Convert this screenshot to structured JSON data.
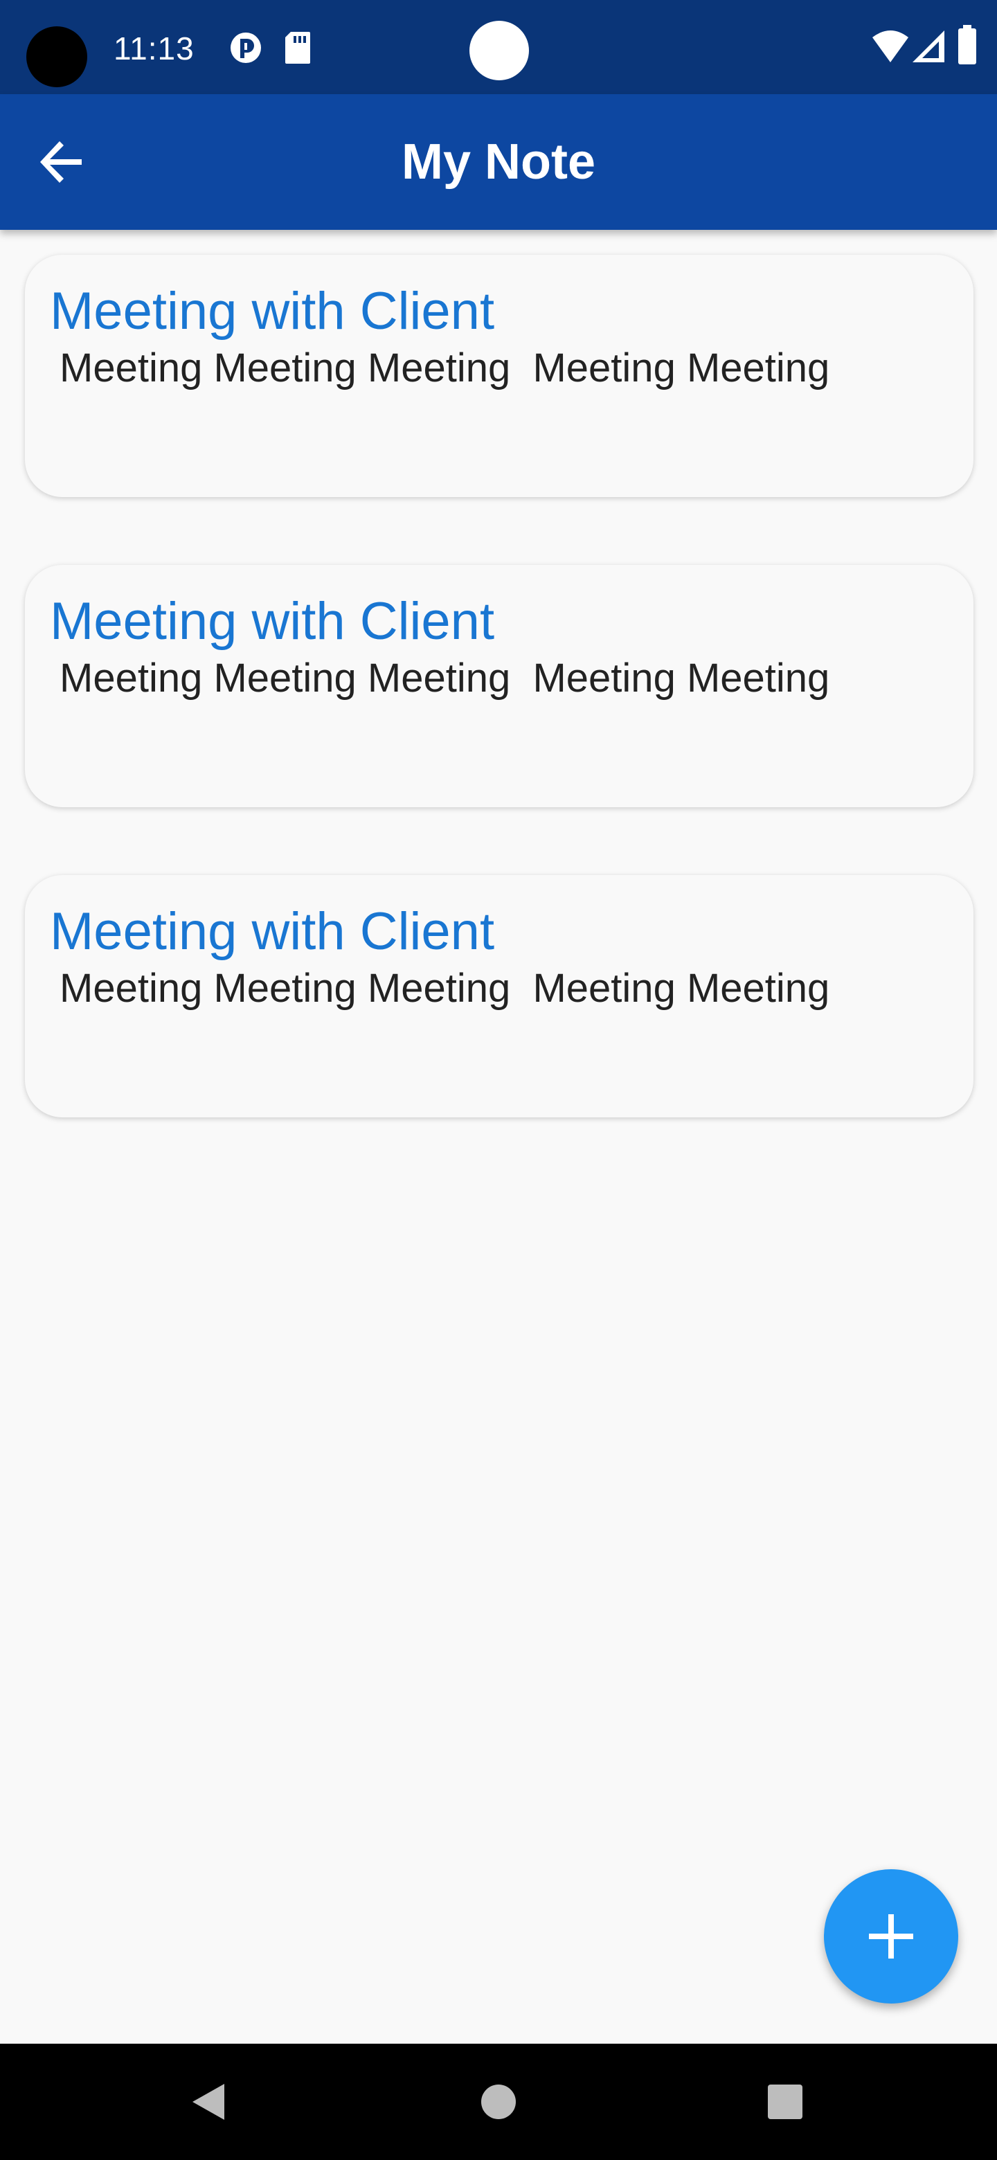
{
  "status_bar": {
    "time": "11:13",
    "icons": [
      "camera-cutout",
      "sync-icon",
      "sd-card-icon",
      "wifi-icon",
      "signal-icon",
      "battery-icon"
    ]
  },
  "app_bar": {
    "title": "My Note",
    "back_icon": "arrow-back-icon"
  },
  "notes": [
    {
      "title": "Meeting with Client",
      "body": "Meeting Meeting Meeting  Meeting Meeting"
    },
    {
      "title": "Meeting with Client",
      "body": "Meeting Meeting Meeting  Meeting Meeting"
    },
    {
      "title": "Meeting with Client",
      "body": "Meeting Meeting Meeting  Meeting Meeting"
    }
  ],
  "fab": {
    "icon": "plus-icon"
  },
  "nav_bar": {
    "buttons": [
      "back-triangle-icon",
      "home-circle-icon",
      "recents-square-icon"
    ]
  },
  "colors": {
    "status_bar": "#0a3578",
    "app_bar": "#0d47a1",
    "note_title": "#1976d2",
    "fab": "#2196f3",
    "background": "#f9f9f9"
  }
}
